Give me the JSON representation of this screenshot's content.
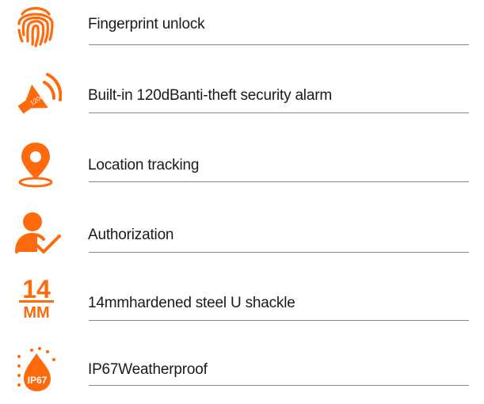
{
  "accent_color": "#ff6a0d",
  "features": [
    {
      "icon": "fingerprint-icon",
      "label": "Fingerprint unlock"
    },
    {
      "icon": "alarm-speaker-icon",
      "label": "Built-in  120dBanti-theft security alarm",
      "icon_text": "120dB"
    },
    {
      "icon": "location-pin-icon",
      "label": "Location tracking"
    },
    {
      "icon": "user-check-icon",
      "label": "Authorization"
    },
    {
      "icon": "shackle-14mm-icon",
      "label": "14mmhardened steel  U shackle",
      "icon_text_top": "14",
      "icon_text_bottom": "MM"
    },
    {
      "icon": "ip67-waterproof-icon",
      "label": "IP67Weatherproof",
      "icon_text": "IP67"
    }
  ]
}
